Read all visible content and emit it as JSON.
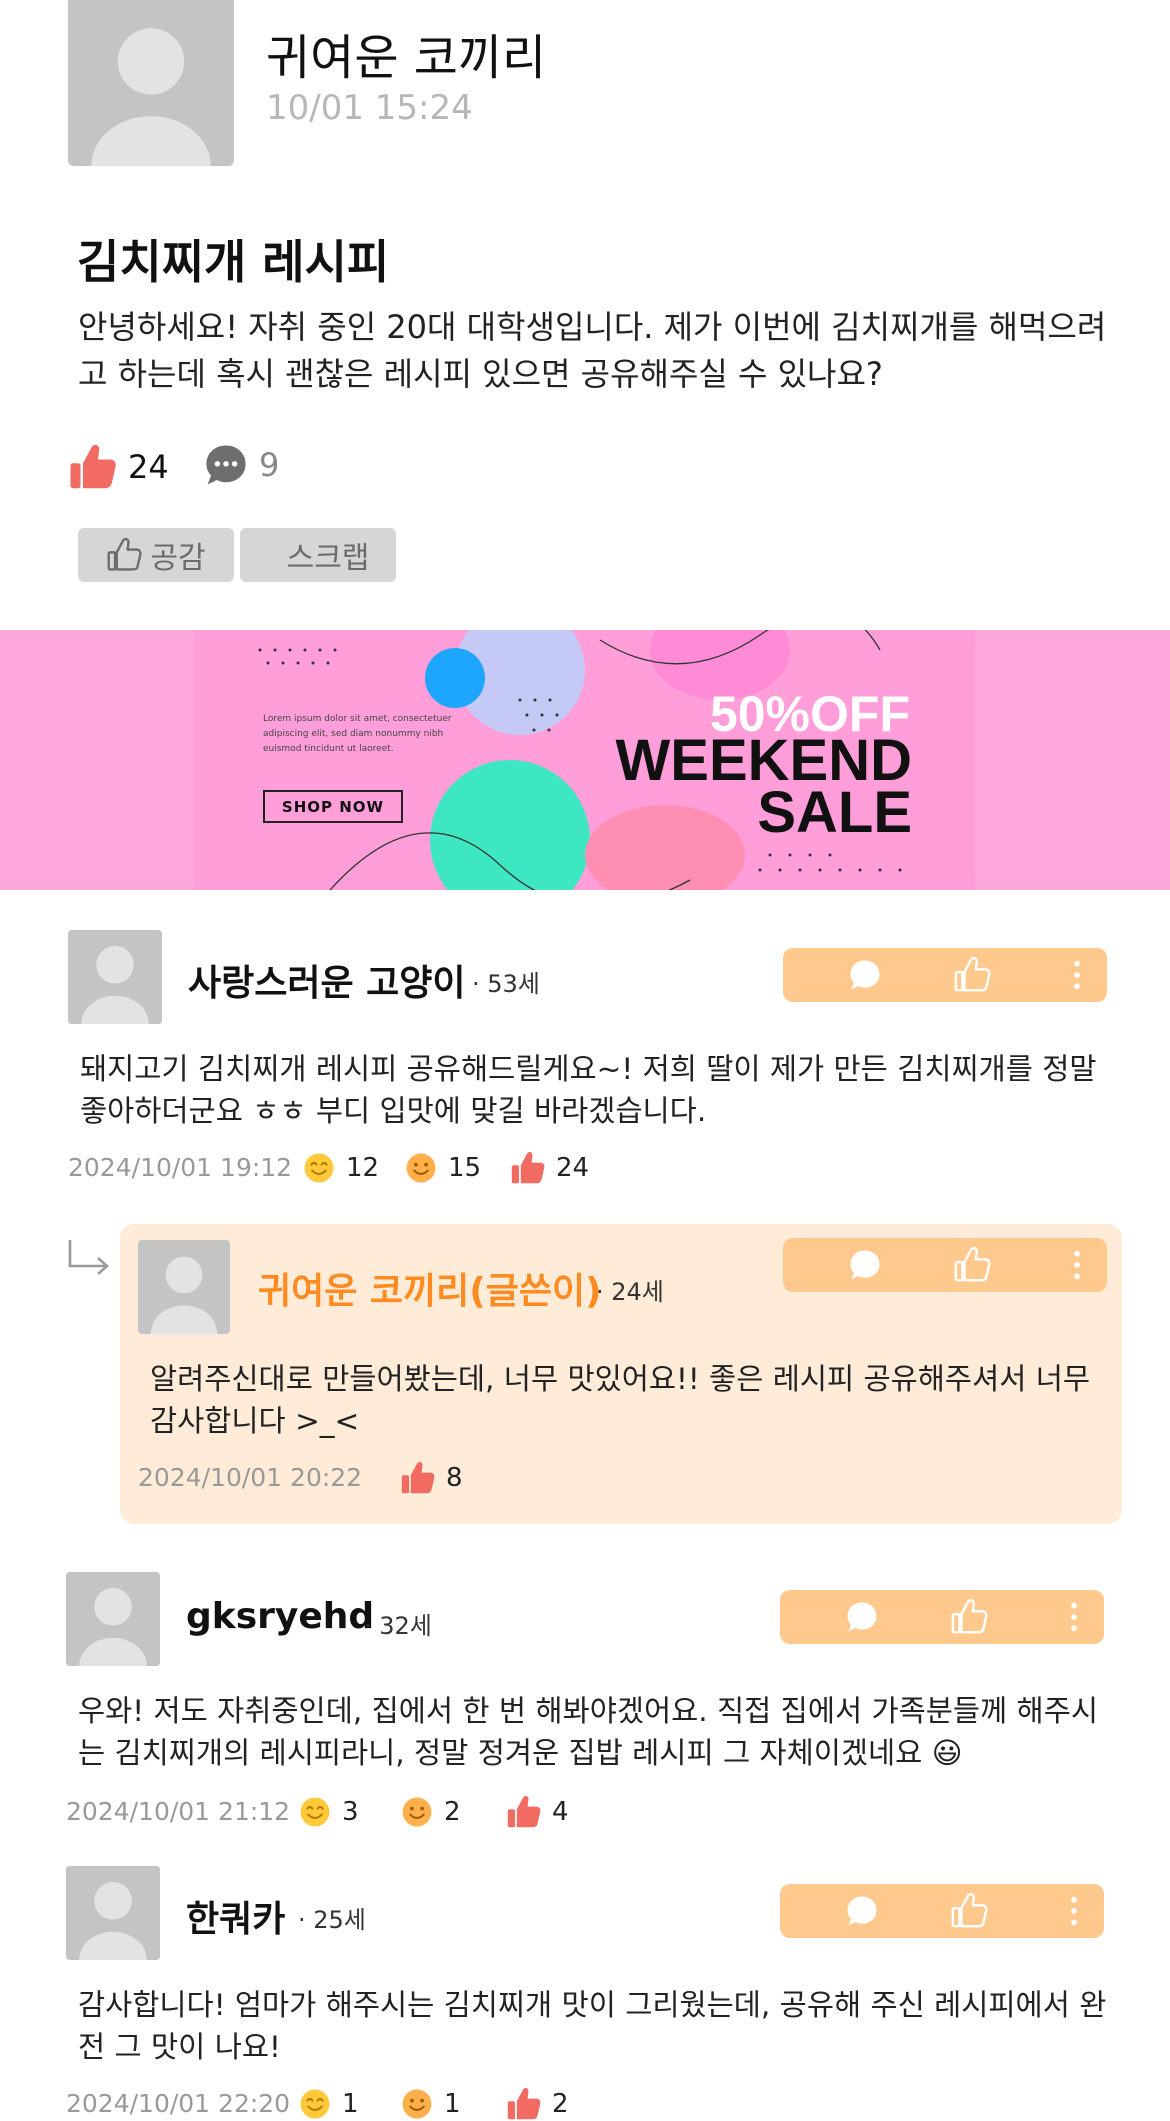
{
  "post": {
    "author": "귀여운 코끼리",
    "time": "10/01  15:24",
    "title": "김치찌개 레시피",
    "body": "안녕하세요! 자취 중인 20대 대학생입니다. 제가 이번에 김치찌개를 해먹으려고 하는데 혹시 괜찮은 레시피 있으면 공유해주실 수 있나요?",
    "likes": "24",
    "comments": "9",
    "empathy_label": "공감",
    "scrap_label": "스크랩"
  },
  "banner": {
    "text": "Lorem ipsum dolor sit amet, consectetuer adipiscing elit, sed diam nonummy nibh euismod tincidunt ut laoreet.",
    "shop_label": "SHOP NOW",
    "off_label": "50%OFF",
    "weekend_label": "WEEKEND",
    "sale_label": "SALE"
  },
  "comments": [
    {
      "name": "사랑스러운 고양이",
      "age": "· 53세",
      "body": "돼지고기 김치찌개 레시피 공유해드릴게요~! 저희 딸이 제가 만든 김치찌개를 정말 좋아하더군요 ㅎㅎ 부디 입맛에 맞길 바라겠습니다.",
      "date": "2024/10/01  19:12",
      "smile": "12",
      "laugh": "15",
      "like": "24"
    },
    {
      "name": "귀여운 코끼리(글쓴이)",
      "age": "· 24세",
      "body": "알려주신대로 만들어봤는데, 너무 맛있어요!! 좋은 레시피 공유해주셔서 너무 감사합니다 >_<",
      "date": "2024/10/01  20:22",
      "like": "8"
    },
    {
      "name": "gksryehd",
      "age": "· 32세",
      "body": "우와! 저도 자취중인데, 집에서 한 번 해봐야겠어요. 직접 집에서 가족분들께 해주시는 김치찌개의 레시피라니, 정말 정겨운 집밥 레시피 그 자체이겠네요 😃",
      "date": "2024/10/01  21:12",
      "smile": "3",
      "laugh": "2",
      "like": "4"
    },
    {
      "name": "한쿼카",
      "age": "· 25세",
      "body": "감사합니다! 엄마가 해주시는 김치찌개 맛이 그리웠는데, 공유해 주신 레시피에서 완전 그 맛이 나요!",
      "date": "2024/10/01  22:20",
      "smile": "1",
      "laugh": "1",
      "like": "2"
    }
  ],
  "colors": {
    "accent_orange": "#ff8a1f",
    "action_bar": "#ffc98e",
    "reply_bg": "#feecd8",
    "like_red": "#f26b63",
    "banner_pink": "#ffa6dd"
  }
}
